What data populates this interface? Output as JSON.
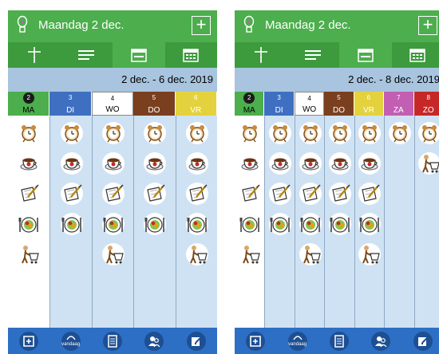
{
  "panels": [
    {
      "title": "Maandag 2 dec.",
      "plus_label": "+",
      "range": "2 dec. - 6 dec. 2019",
      "days": [
        {
          "num": "2",
          "name": "MA",
          "color": "#4cae4c",
          "today": true
        },
        {
          "num": "3",
          "name": "DI",
          "color": "#3e6fc1"
        },
        {
          "num": "4",
          "name": "WO",
          "color": "#ffffff",
          "current": true
        },
        {
          "num": "5",
          "name": "DO",
          "color": "#7a3f1f"
        },
        {
          "num": "6",
          "name": "VR",
          "color": "#e3d23d"
        }
      ],
      "columns": [
        [
          "alarm-clock-icon",
          "coffee-cup-icon",
          "writing-icon",
          "dinner-plate-icon",
          "shopping-cart-icon"
        ],
        [
          "alarm-clock-icon",
          "coffee-cup-icon",
          "writing-icon",
          "dinner-plate-icon"
        ],
        [
          "alarm-clock-icon",
          "coffee-cup-icon",
          "writing-icon",
          "dinner-plate-icon",
          "shopping-cart-icon"
        ],
        [
          "alarm-clock-icon",
          "coffee-cup-icon",
          "writing-icon",
          "dinner-plate-icon"
        ],
        [
          "alarm-clock-icon",
          "coffee-cup-icon",
          "writing-icon",
          "dinner-plate-icon",
          "shopping-cart-icon"
        ]
      ]
    },
    {
      "title": "Maandag 2 dec.",
      "plus_label": "+",
      "range": "2 dec. - 8 dec. 2019",
      "days": [
        {
          "num": "2",
          "name": "MA",
          "color": "#4cae4c",
          "today": true
        },
        {
          "num": "3",
          "name": "DI",
          "color": "#3e6fc1"
        },
        {
          "num": "4",
          "name": "WO",
          "color": "#ffffff",
          "current": true
        },
        {
          "num": "5",
          "name": "DO",
          "color": "#7a3f1f"
        },
        {
          "num": "6",
          "name": "VR",
          "color": "#e3d23d"
        },
        {
          "num": "7",
          "name": "ZA",
          "color": "#c25fb2"
        },
        {
          "num": "8",
          "name": "ZO",
          "color": "#c62828"
        }
      ],
      "columns": [
        [
          "alarm-clock-icon",
          "coffee-cup-icon",
          "writing-icon",
          "dinner-plate-icon",
          "shopping-cart-icon"
        ],
        [
          "alarm-clock-icon",
          "coffee-cup-icon",
          "writing-icon",
          "dinner-plate-icon"
        ],
        [
          "alarm-clock-icon",
          "coffee-cup-icon",
          "writing-icon",
          "dinner-plate-icon",
          "shopping-cart-icon"
        ],
        [
          "alarm-clock-icon",
          "coffee-cup-icon",
          "writing-icon",
          "dinner-plate-icon"
        ],
        [
          "alarm-clock-icon",
          "coffee-cup-icon",
          "writing-icon",
          "dinner-plate-icon",
          "shopping-cart-icon"
        ],
        [
          "alarm-clock-icon"
        ],
        [
          "alarm-clock-icon",
          "shopping-cart-icon"
        ]
      ]
    }
  ],
  "toolbar_icons": [
    "timeline-icon",
    "list-icon",
    "calendar-week-icon",
    "calendar-month-icon"
  ],
  "bottom_buttons": [
    {
      "icon": "add-note-icon"
    },
    {
      "icon": "today-icon",
      "label": "vandaag"
    },
    {
      "icon": "document-icon"
    },
    {
      "icon": "contacts-icon"
    },
    {
      "icon": "edit-icon"
    }
  ],
  "colors": {
    "header": "#4cae4c",
    "toolbar": "#3d9a3d",
    "range_bar": "#a8c4de",
    "column_bg": "#cfe2f3",
    "bottom_bar": "#2d6fc4"
  }
}
